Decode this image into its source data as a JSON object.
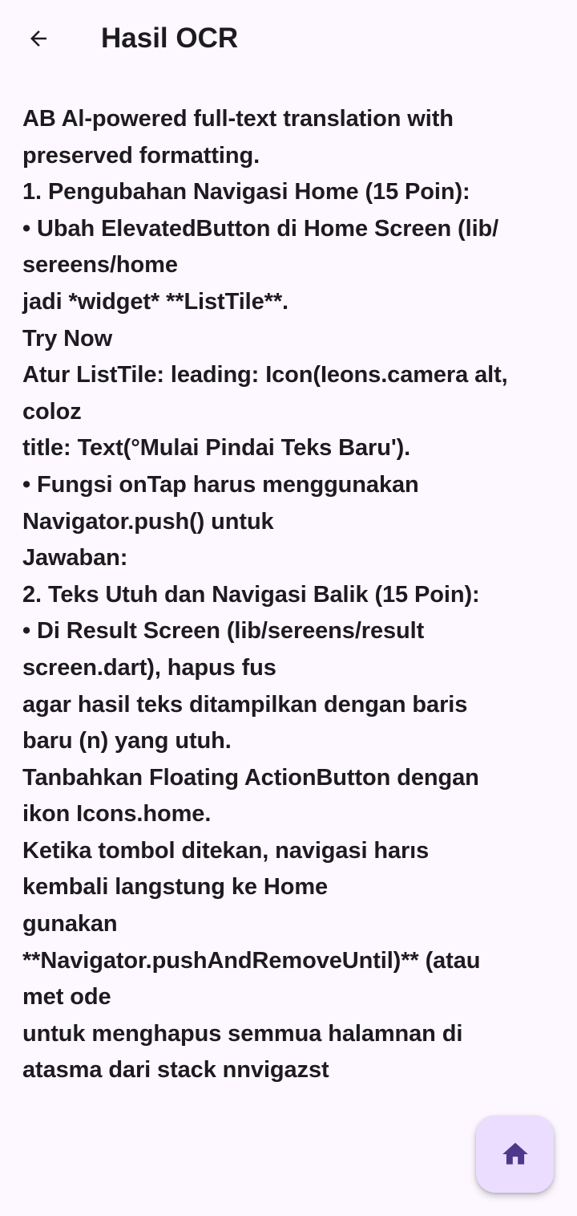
{
  "app_bar": {
    "title": "Hasil OCR",
    "back_icon": "arrow-back-icon"
  },
  "ocr_text": {
    "lines": [
      "AB Al-powered full-text translation with",
      "preserved formatting.",
      "1. Pengubahan Navigasi Home (15 Poin):",
      "• Ubah ElevatedButton di Home Screen (lib/",
      "sereens/home",
      "jadi *widget* **ListTile**.",
      "Try Now",
      "Atur ListTile: leading: Icon(Ieons.camera alt,",
      "coloz",
      "title: Text(°Mulai Pindai Teks Baru').",
      "• Fungsi onTap harus menggunakan",
      "Navigator.push() untuk",
      "Jawaban:",
      "2. Teks Utuh dan Navigasi Balik (15 Poin):",
      "• Di Result Screen (lib/sereens/result",
      "screen.dart), hapus fus",
      "agar hasil teks ditampilkan dengan baris",
      "baru (n) yang utuh.",
      "Tanbahkan Floating ActionButton dengan",
      "ikon Icons.home.",
      "Ketika tombol ditekan, navigasi harıs",
      "kembali langstung ke Home",
      "gunakan",
      "**Navigator.pushAndRemoveUntil)** (atau",
      "met ode",
      "untuk menghapus semmua halamnan di",
      "atasma dari stack nnvigazst"
    ]
  },
  "fab": {
    "icon": "home-icon",
    "background": "#EADDFF",
    "icon_color": "#4F378B"
  },
  "colors": {
    "background": "#FDF7FF",
    "text": "#1D1B20"
  }
}
